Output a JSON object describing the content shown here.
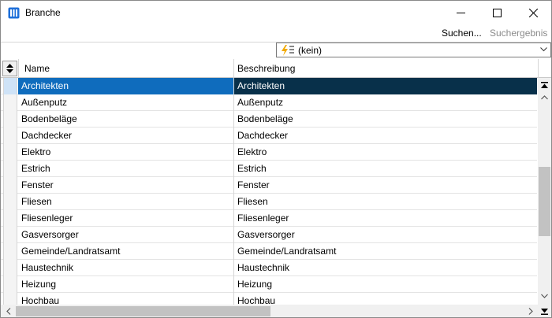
{
  "window": {
    "title": "Branche"
  },
  "toolbar": {
    "search_label": "Suchen...",
    "result_label": "Suchergebnis"
  },
  "filter": {
    "selected": "(kein)"
  },
  "grid": {
    "columns": [
      "Name",
      "Beschreibung"
    ],
    "rows": [
      {
        "name": "Architekten",
        "description": "Architekten"
      },
      {
        "name": "Außenputz",
        "description": "Außenputz"
      },
      {
        "name": "Bodenbeläge",
        "description": "Bodenbeläge"
      },
      {
        "name": "Dachdecker",
        "description": "Dachdecker"
      },
      {
        "name": "Elektro",
        "description": "Elektro"
      },
      {
        "name": "Estrich",
        "description": "Estrich"
      },
      {
        "name": "Fenster",
        "description": "Fenster"
      },
      {
        "name": "Fliesen",
        "description": "Fliesen"
      },
      {
        "name": "Fliesenleger",
        "description": "Fliesenleger"
      },
      {
        "name": "Gasversorger",
        "description": "Gasversorger"
      },
      {
        "name": "Gemeinde/Landratsamt",
        "description": "Gemeinde/Landratsamt"
      },
      {
        "name": "Haustechnik",
        "description": "Haustechnik"
      },
      {
        "name": "Heizung",
        "description": "Heizung"
      },
      {
        "name": "Hochbau",
        "description": "Hochbau"
      }
    ],
    "selected_row": 0
  },
  "colors": {
    "selection_name": "#0f6cbd",
    "selection_desc": "#08304a",
    "title_icon": "#1e6fd9"
  },
  "icons": {
    "app": "grid-app-icon",
    "minimize": "minimize-icon",
    "maximize": "maximize-icon",
    "close": "close-icon",
    "filter": "lightning-list-icon",
    "dropdown": "chevron-down-icon",
    "sort": "sort-updown-icon"
  }
}
